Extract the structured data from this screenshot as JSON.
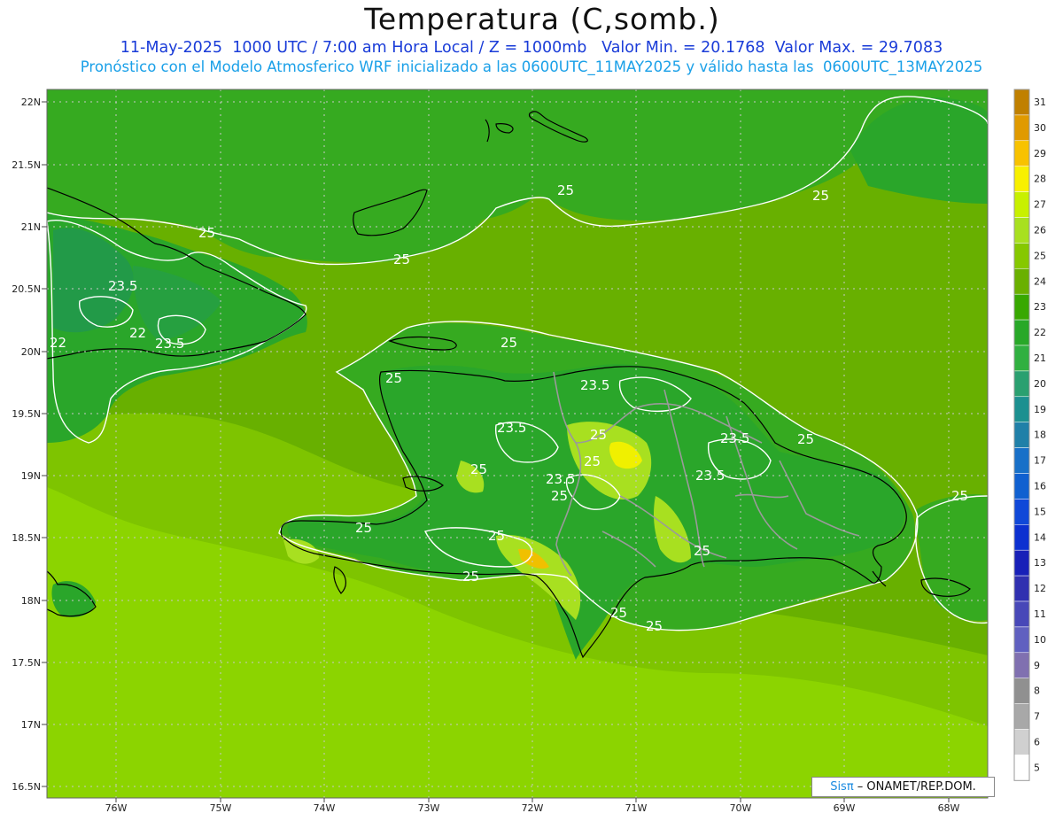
{
  "title": "Temperatura (C,somb.)",
  "subtitle_line1": "11-May-2025  1000 UTC / 7:00 am Hora Local / Z = 1000mb   Valor Min. = 20.1768  Valor Max. = 29.7083",
  "subtitle_line2": "Pronóstico con el Modelo Atmosferico WRF inicializado a las 0600UTC_11MAY2025 y válido hasta las  0600UTC_13MAY2025",
  "credit": {
    "brand": "Sisπ",
    "org": " – ONAMET/REP.DOM."
  },
  "lat_labels": [
    "22N",
    "21.5N",
    "21N",
    "20.5N",
    "20N",
    "19.5N",
    "19N",
    "18.5N",
    "18N",
    "17.5N",
    "17N",
    "16.5N"
  ],
  "lon_labels": [
    "76W",
    "75W",
    "74W",
    "73W",
    "72W",
    "71W",
    "70W",
    "69W",
    "68W"
  ],
  "colorbar": {
    "values": [
      "31",
      "30",
      "29",
      "28",
      "27",
      "26",
      "25",
      "24",
      "23",
      "22",
      "21",
      "20",
      "19",
      "18",
      "17",
      "16",
      "15",
      "14",
      "13",
      "12",
      "11",
      "10",
      "9",
      "8",
      "7",
      "6",
      "5"
    ],
    "colors": [
      "#c08000",
      "#e09a00",
      "#f8c200",
      "#f8f000",
      "#c8f000",
      "#a8e020",
      "#86c800",
      "#6ab000",
      "#38a800",
      "#28a828",
      "#30b040",
      "#2aa070",
      "#1c9090",
      "#2080a8",
      "#1870c8",
      "#1060d0",
      "#1048d8",
      "#0c30d0",
      "#1820b8",
      "#3030b0",
      "#4848b8",
      "#6060c0",
      "#8070b0",
      "#909090",
      "#a8a8a8",
      "#d0d0d0",
      "#ffffff"
    ]
  },
  "contour_labels": [
    "25",
    "25",
    "25",
    "25",
    "25",
    "25",
    "25",
    "25",
    "25",
    "25",
    "25",
    "25",
    "25",
    "25",
    "25",
    "25",
    "25",
    "25",
    "23.5",
    "23.5",
    "23.5",
    "23.5",
    "23.5",
    "23.5",
    "23.5",
    "22",
    "22"
  ],
  "colors": {
    "ocean_far": "#8cd400",
    "ocean_mid": "#78c000",
    "ocean_near": "#62aa00",
    "land": "#2aa62a",
    "land_cool": "#229a48",
    "land_warm": "#a8e020",
    "hot": "#f0f000",
    "title_blue": "#1a3cd8",
    "sub_blue": "#1aa0e8"
  }
}
